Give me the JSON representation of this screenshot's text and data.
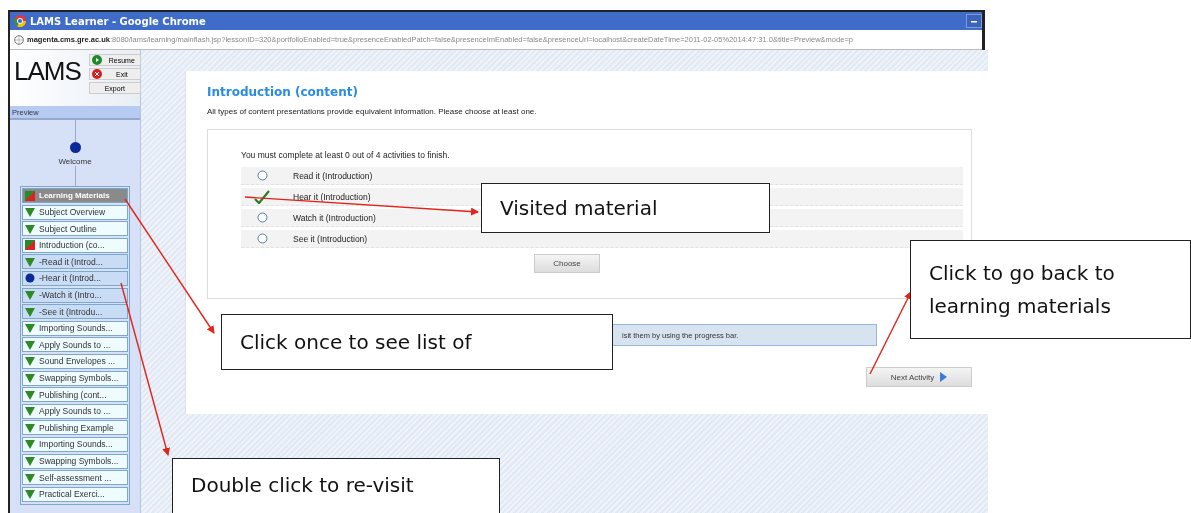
{
  "window": {
    "title": "LAMS Learner - Google Chrome",
    "url_host": "magenta.cms.gre.ac.uk",
    "url_path": ":8080/lams/learning/mainflash.jsp?lessonID=320&portfolioEnabled=true&presenceEnabledPatch=false&presenceImEnabled=false&presenceUrl=localhost&createDateTime=2011-02-05%2014:47:31.0&title=Preview&mode=p"
  },
  "logo": "LAMS",
  "controls": [
    {
      "label": "Resume",
      "kind": "resume"
    },
    {
      "label": "Exit",
      "kind": "exit"
    },
    {
      "label": "Export",
      "kind": "plain"
    }
  ],
  "sidebar": {
    "header": "Preview",
    "welcome": "Welcome",
    "items": [
      {
        "label": "Learning Materials",
        "kind": "flag",
        "selected": true,
        "children": [
          {
            "label": "Subject Overview",
            "kind": "triangle",
            "selected": false
          },
          {
            "label": "Subject Outline",
            "kind": "triangle",
            "selected": false
          },
          {
            "label": "Introduction (co...",
            "kind": "flag",
            "selected": false,
            "children": [
              {
                "label": "-Read it (Introd...",
                "kind": "triangle",
                "selected": false
              },
              {
                "label": "-Hear it (Introd...",
                "kind": "dot",
                "selected": false
              },
              {
                "label": "-Watch it (Intro...",
                "kind": "triangle",
                "selected": false
              },
              {
                "label": "-See it (Introdu...",
                "kind": "triangle",
                "selected": false
              }
            ]
          },
          {
            "label": "Importing Sounds...",
            "kind": "triangle",
            "selected": false
          },
          {
            "label": "Apply Sounds to ...",
            "kind": "triangle",
            "selected": false
          },
          {
            "label": "Sound Envelopes ...",
            "kind": "triangle",
            "selected": false
          },
          {
            "label": "Swapping Symbols...",
            "kind": "triangle",
            "selected": false
          },
          {
            "label": "Publishing (cont...",
            "kind": "triangle",
            "selected": false
          },
          {
            "label": "Apply Sounds to ...",
            "kind": "triangle",
            "selected": false
          },
          {
            "label": "Publishing Example",
            "kind": "triangle",
            "selected": false
          },
          {
            "label": "Importing Sounds...",
            "kind": "triangle",
            "selected": false
          },
          {
            "label": "Swapping Symbols...",
            "kind": "triangle",
            "selected": false
          },
          {
            "label": "Self-assessment ...",
            "kind": "triangle",
            "selected": false
          },
          {
            "label": "Practical Exerci...",
            "kind": "triangle",
            "selected": false
          }
        ]
      }
    ]
  },
  "content": {
    "title": "Introduction (content)",
    "description": "All types of content presentations provide equivalent information. Please choose at least one.",
    "requirement": "You must complete at least 0 out of 4 activities to finish.",
    "options": [
      {
        "label": "Read it (Introduction)",
        "visited": false
      },
      {
        "label": "Hear it (Introduction)",
        "visited": true
      },
      {
        "label": "Watch it (Introduction)",
        "visited": false
      },
      {
        "label": "See it (Introduction)",
        "visited": false
      }
    ],
    "choose_button": "Choose",
    "info": "isit them by using the progress bar.",
    "next_button": "Next Activity"
  },
  "callouts": [
    {
      "text": "Visited material"
    },
    {
      "text": "Click to go back to learning materials"
    },
    {
      "text": "Click once to see list of"
    },
    {
      "text": "Double click to re-visit"
    }
  ]
}
